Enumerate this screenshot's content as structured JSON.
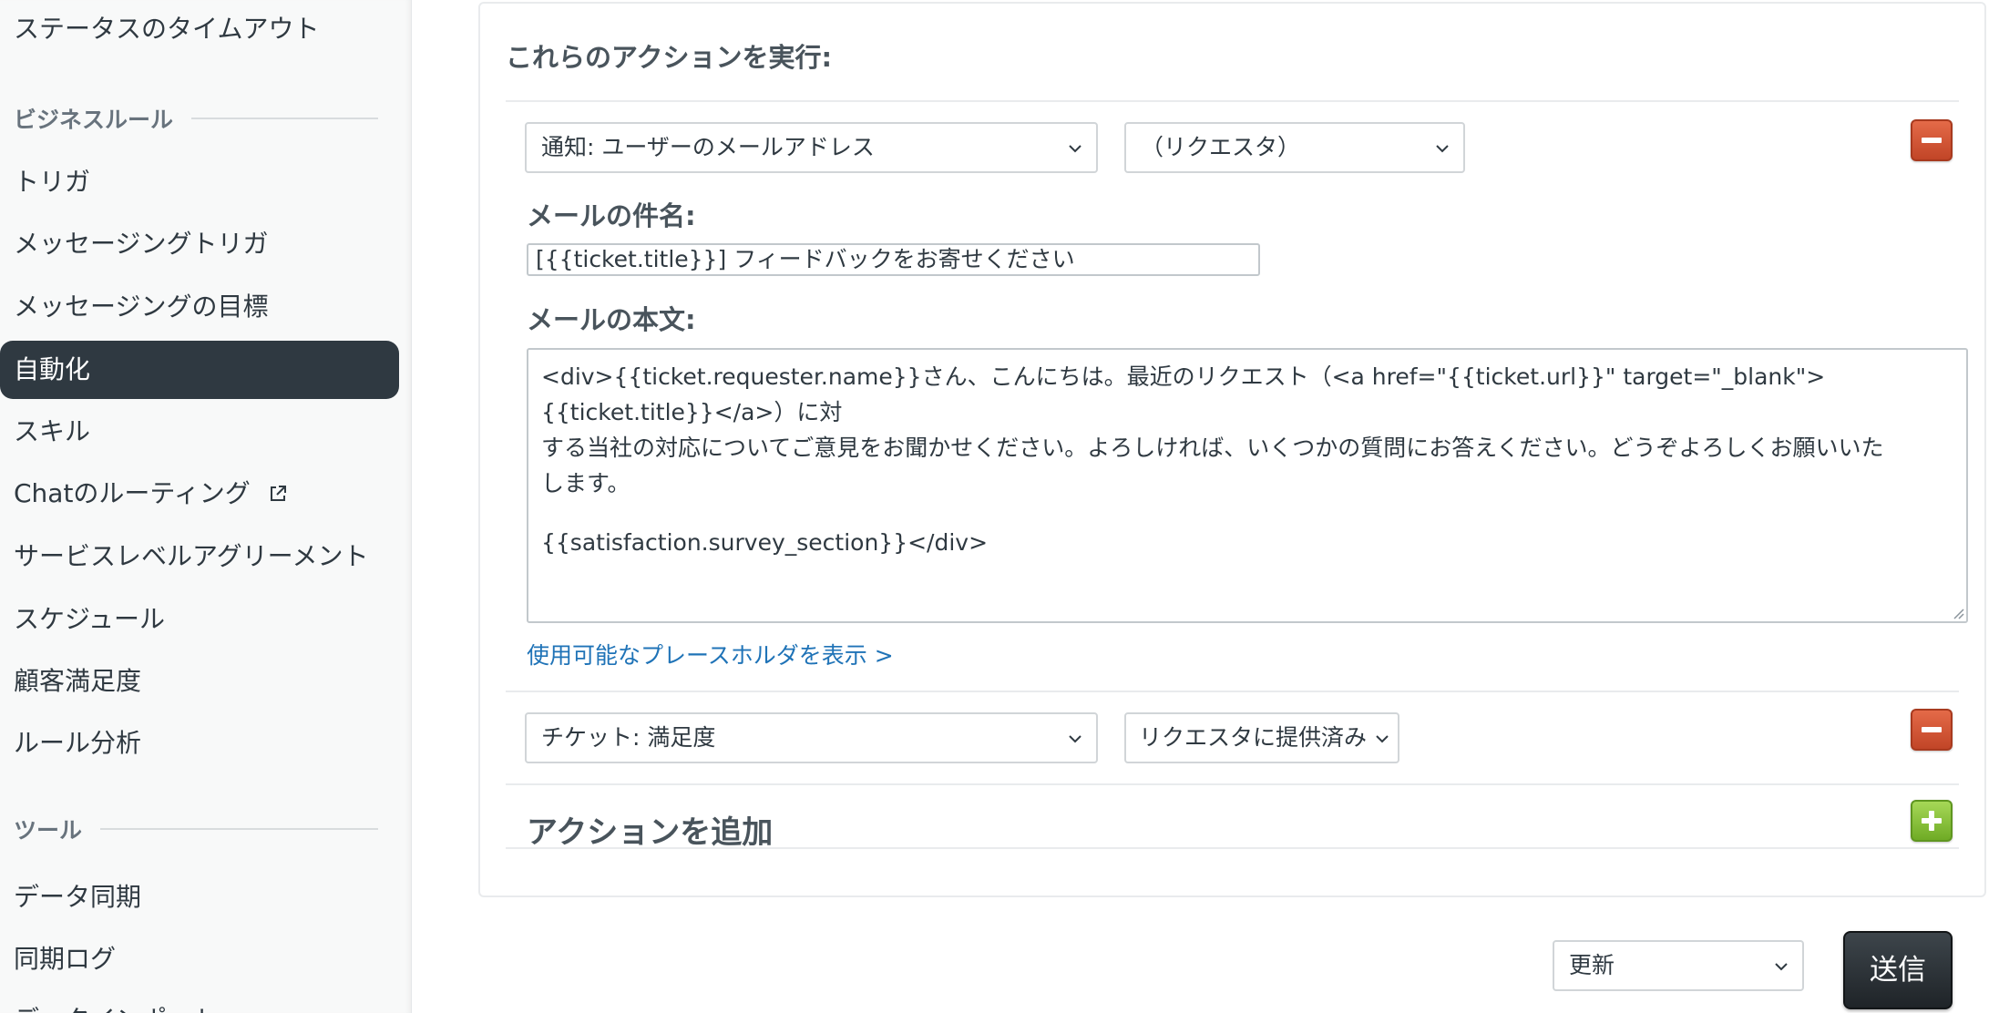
{
  "sidebar": {
    "top_item": "ステータスのタイムアウト",
    "business_rules": {
      "heading": "ビジネスルール",
      "items": [
        {
          "label": "トリガ"
        },
        {
          "label": "メッセージングトリガ"
        },
        {
          "label": "メッセージングの目標"
        },
        {
          "label": "自動化",
          "active": true
        },
        {
          "label": "スキル"
        },
        {
          "label": "Chatのルーティング",
          "external": true
        },
        {
          "label": "サービスレベルアグリーメント"
        },
        {
          "label": "スケジュール"
        },
        {
          "label": "顧客満足度"
        },
        {
          "label": "ルール分析"
        }
      ]
    },
    "tools": {
      "heading": "ツール",
      "items": [
        {
          "label": "データ同期"
        },
        {
          "label": "同期ログ"
        },
        {
          "label": "データインポート"
        }
      ]
    }
  },
  "actions": {
    "heading": "これらのアクションを実行:",
    "action1": {
      "type_select": "通知: ユーザーのメールアドレス",
      "target_select": "（リクエスタ）",
      "subject_label": "メールの件名:",
      "subject_value": "[{{ticket.title}}] フィードバックをお寄せください",
      "body_label": "メールの本文:",
      "body_line1": "<div>{{ticket.requester.name}}さん、こんにちは。最近のリクエスト（<a href=\"{{ticket.url}}\" target=\"_blank\">{{ticket.title}}</a>）に対",
      "body_line2": "する当社の対応についてご意見をお聞かせください。よろしければ、いくつかの質問にお答えください。どうぞよろしくお願いいた",
      "body_line3": "します。",
      "body_line4": "{{satisfaction.survey_section}}</div>",
      "placeholder_link": "使用可能なプレースホルダを表示 >"
    },
    "action2": {
      "type_select": "チケット: 満足度",
      "value_select": "リクエスタに提供済み"
    },
    "add_label": "アクションを追加"
  },
  "footer": {
    "mode_select": "更新",
    "submit_label": "送信"
  },
  "colors": {
    "active_nav_bg": "#2f3941",
    "link": "#1f73b7",
    "remove_button": "#d2542f",
    "add_button": "#86c440",
    "submit_bg": "#2a3035"
  }
}
